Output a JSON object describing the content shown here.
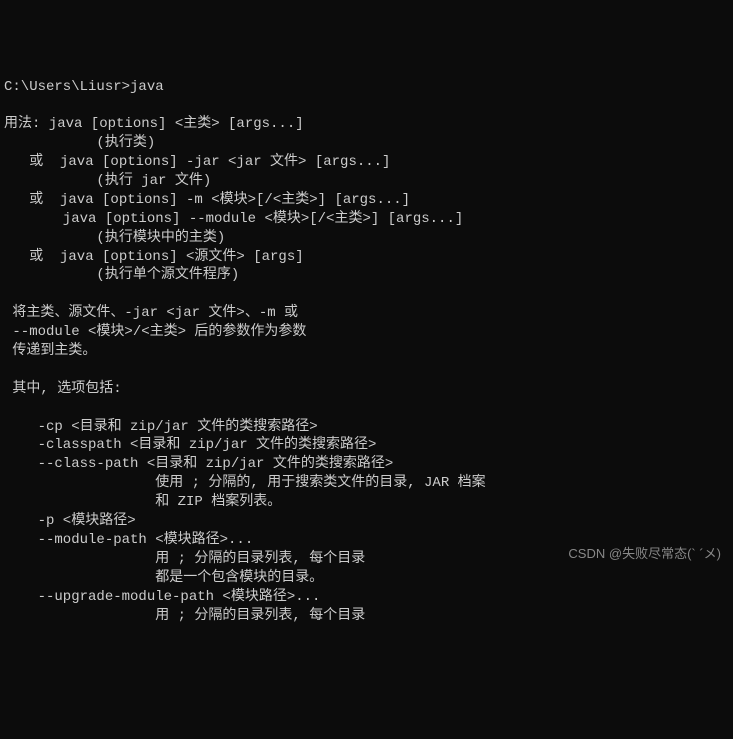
{
  "prompt": "C:\\Users\\Liusr>java",
  "lines": [
    "用法: java [options] <主类> [args...]",
    "           (执行类)",
    "   或  java [options] -jar <jar 文件> [args...]",
    "           (执行 jar 文件)",
    "   或  java [options] -m <模块>[/<主类>] [args...]",
    "       java [options] --module <模块>[/<主类>] [args...]",
    "           (执行模块中的主类)",
    "   或  java [options] <源文件> [args]",
    "           (执行单个源文件程序)",
    "",
    " 将主类、源文件、-jar <jar 文件>、-m 或",
    " --module <模块>/<主类> 后的参数作为参数",
    " 传递到主类。",
    "",
    " 其中, 选项包括:",
    "",
    "    -cp <目录和 zip/jar 文件的类搜索路径>",
    "    -classpath <目录和 zip/jar 文件的类搜索路径>",
    "    --class-path <目录和 zip/jar 文件的类搜索路径>",
    "                  使用 ; 分隔的, 用于搜索类文件的目录, JAR 档案",
    "                  和 ZIP 档案列表。",
    "    -p <模块路径>",
    "    --module-path <模块路径>...",
    "                  用 ; 分隔的目录列表, 每个目录",
    "                  都是一个包含模块的目录。",
    "    --upgrade-module-path <模块路径>...",
    "                  用 ; 分隔的目录列表, 每个目录"
  ],
  "watermark": "CSDN @失败尽常态(` ´メ)"
}
